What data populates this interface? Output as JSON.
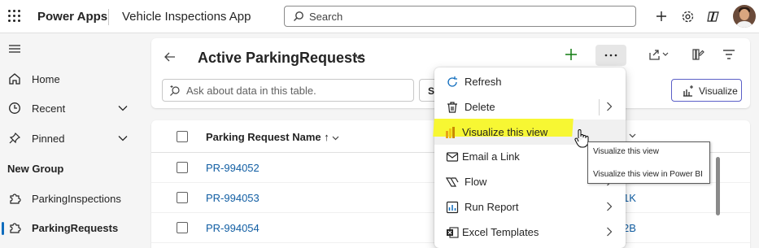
{
  "topbar": {
    "brand": "Power Apps",
    "app_name": "Vehicle Inspections App",
    "search_label": "Search"
  },
  "nav": {
    "home": "Home",
    "recent": "Recent",
    "pinned": "Pinned",
    "group_title": "New Group",
    "items": [
      {
        "label": "ParkingInspections"
      },
      {
        "label": "ParkingRequests",
        "selected": true
      }
    ]
  },
  "commandbar": {
    "view_title": "Active ParkingRequests",
    "ask_placeholder": "Ask about data in this table.",
    "st_label": "St",
    "visualize_label": "Visualize"
  },
  "grid": {
    "column_name": "Parking Request Name",
    "sort_indicator": "↑",
    "rows": [
      {
        "name": "PR-994052",
        "extra": ""
      },
      {
        "name": "PR-994053",
        "extra": "1K"
      },
      {
        "name": "PR-994054",
        "extra": "2B"
      }
    ]
  },
  "menu": {
    "items": [
      {
        "label": "Refresh",
        "icon": "refresh-icon"
      },
      {
        "label": "Delete",
        "icon": "trash-icon"
      },
      {
        "label": "Visualize this view",
        "icon": "powerbi-icon"
      },
      {
        "label": "Email a Link",
        "icon": "mail-icon"
      },
      {
        "label": "Flow",
        "icon": "flow-icon"
      },
      {
        "label": "Run Report",
        "icon": "report-icon"
      },
      {
        "label": "Excel Templates",
        "icon": "excel-icon"
      }
    ]
  },
  "tooltip": {
    "title": "Visualize this view",
    "description": "Visualize this view in Power BI"
  },
  "colors": {
    "accent": "#0f6cbd",
    "link": "#115ea3",
    "highlight": "#f7f733",
    "visualize_border": "#5b5fc7"
  }
}
